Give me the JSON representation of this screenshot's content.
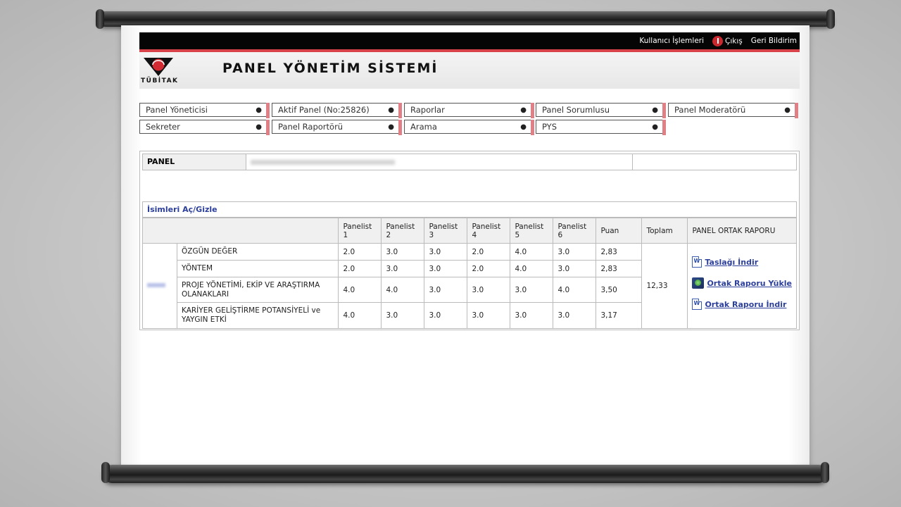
{
  "topbar": {
    "user_ops": "Kullanıcı İşlemleri",
    "logout": "Çıkış",
    "feedback": "Geri Bildirim"
  },
  "header": {
    "logo_text": "TÜBİTAK",
    "title": "PANEL YÖNETİM SİSTEMİ"
  },
  "menus": [
    {
      "label": "Panel Yöneticisi"
    },
    {
      "label": "Aktif Panel (No:25826)"
    },
    {
      "label": "Raporlar"
    },
    {
      "label": "Panel Sorumlusu"
    },
    {
      "label": "Panel Moderatörü"
    },
    {
      "label": "Sekreter"
    },
    {
      "label": "Panel Raportörü"
    },
    {
      "label": "Arama"
    },
    {
      "label": "PYS"
    }
  ],
  "panel": {
    "label": "PANEL"
  },
  "toggle_names": "İsimleri Aç/Gizle",
  "table": {
    "headers": [
      "",
      "Panelist 1",
      "Panelist 2",
      "Panelist 3",
      "Panelist 4",
      "Panelist 5",
      "Panelist 6",
      "Puan",
      "Toplam",
      "PANEL ORTAK RAPORU"
    ],
    "rows": [
      {
        "criterion": "ÖZGÜN DEĞER",
        "scores": [
          "2.0",
          "3.0",
          "3.0",
          "2.0",
          "4.0",
          "3.0"
        ],
        "puan": "2,83"
      },
      {
        "criterion": "YÖNTEM",
        "scores": [
          "2.0",
          "3.0",
          "3.0",
          "2.0",
          "4.0",
          "3.0"
        ],
        "puan": "2,83"
      },
      {
        "criterion": "PROJE YÖNETİMİ, EKİP VE ARAŞTIRMA OLANAKLARI",
        "scores": [
          "4.0",
          "4.0",
          "3.0",
          "3.0",
          "3.0",
          "4.0"
        ],
        "puan": "3,50"
      },
      {
        "criterion": "KARİYER GELİŞTİRME POTANSİYELİ ve YAYGIN ETKİ",
        "scores": [
          "4.0",
          "3.0",
          "3.0",
          "3.0",
          "3.0",
          "3.0"
        ],
        "puan": "3,17"
      }
    ],
    "total": "12,33",
    "actions": {
      "draft_download": "Taslağı İndir",
      "upload_report": "Ortak Raporu Yükle",
      "download_report": "Ortak Raporu İndir"
    }
  }
}
